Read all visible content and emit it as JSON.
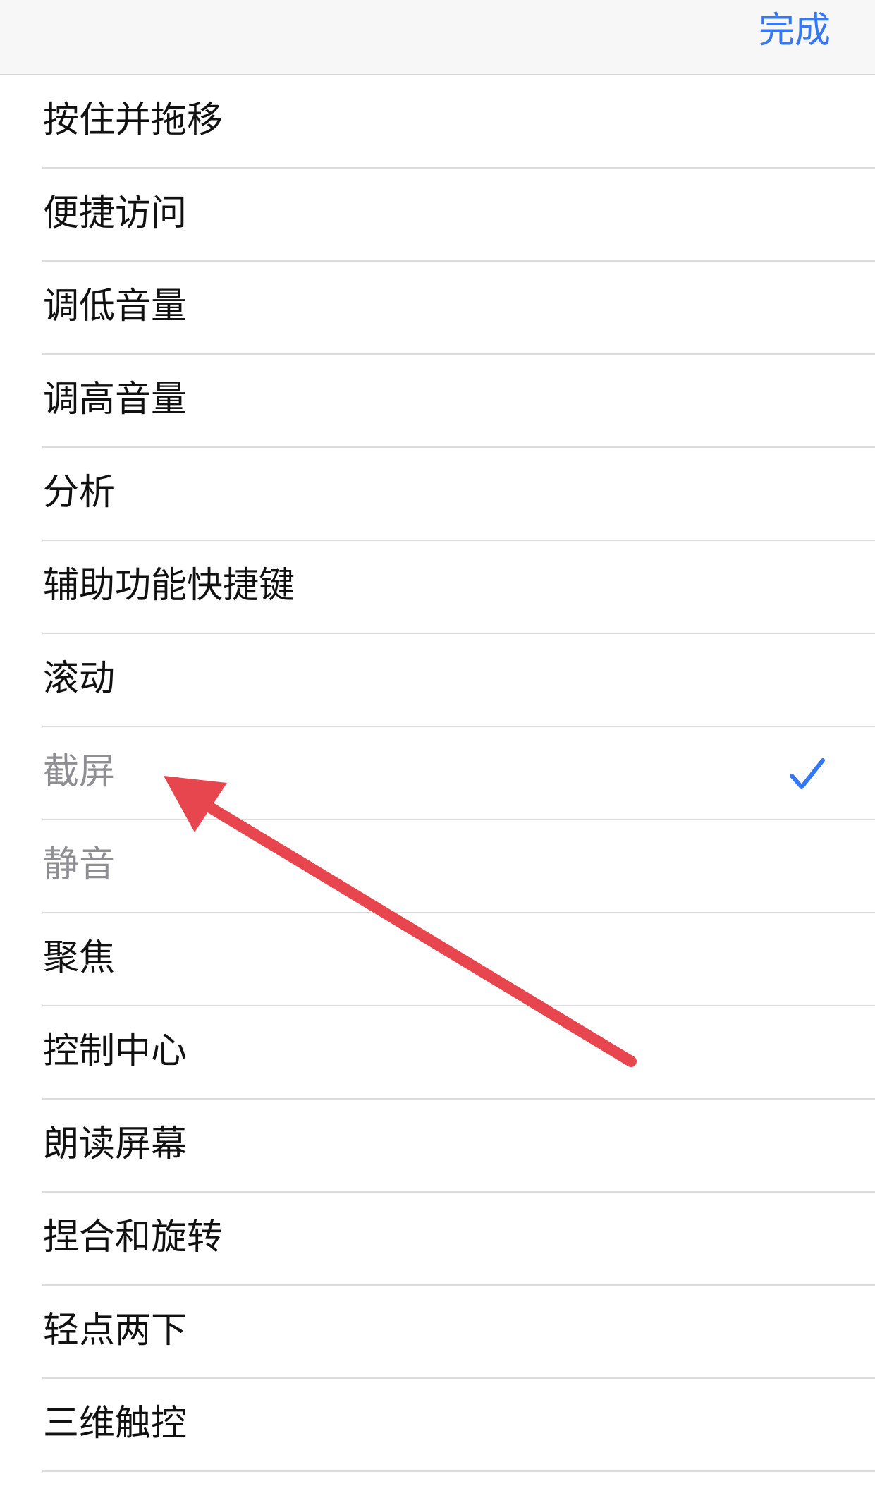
{
  "nav": {
    "done_label": "完成"
  },
  "items": [
    {
      "label": "按住并拖移",
      "state": "normal"
    },
    {
      "label": "便捷访问",
      "state": "normal"
    },
    {
      "label": "调低音量",
      "state": "normal"
    },
    {
      "label": "调高音量",
      "state": "normal"
    },
    {
      "label": "分析",
      "state": "normal"
    },
    {
      "label": "辅助功能快捷键",
      "state": "normal"
    },
    {
      "label": "滚动",
      "state": "normal"
    },
    {
      "label": "截屏",
      "state": "dimmed",
      "selected": true
    },
    {
      "label": "静音",
      "state": "dimmed"
    },
    {
      "label": "聚焦",
      "state": "normal"
    },
    {
      "label": "控制中心",
      "state": "normal"
    },
    {
      "label": "朗读屏幕",
      "state": "normal"
    },
    {
      "label": "捏合和旋转",
      "state": "normal"
    },
    {
      "label": "轻点两下",
      "state": "normal"
    },
    {
      "label": "三维触控",
      "state": "normal"
    }
  ],
  "colors": {
    "accent": "#3478f6",
    "dimmed_text": "#8e8e93",
    "arrow": "#e8464f"
  },
  "icons": {
    "selected_marker": "checkmark-icon",
    "annotation": "arrow-icon"
  }
}
